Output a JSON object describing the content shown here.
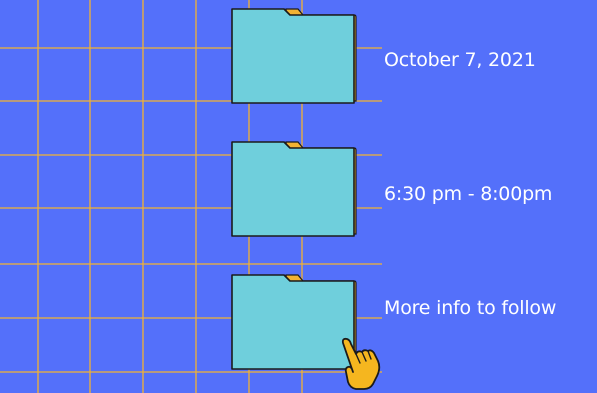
{
  "colors": {
    "background": "#5470fa",
    "grid_lines": "#f2b233",
    "folder_front": "#6fcfdc",
    "folder_back": "#f2b233",
    "outline": "#1b1b1b",
    "text": "#ffffff",
    "hand": "#f5b61f"
  },
  "details": [
    {
      "text": "October 7, 2021",
      "icon": "folder-icon"
    },
    {
      "text": "6:30 pm - 8:00pm",
      "icon": "folder-icon"
    },
    {
      "text": "More info to follow",
      "icon": "folder-icon"
    }
  ],
  "cursor_icon": "pointing-hand-cursor-icon"
}
